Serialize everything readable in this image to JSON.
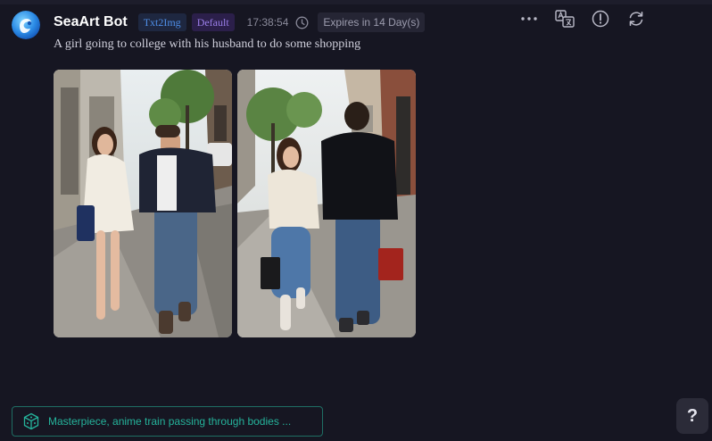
{
  "message": {
    "bot_name": "SeaArt Bot",
    "tags": [
      "Txt2Img",
      "Default"
    ],
    "time": "17:38:54",
    "expires": "Expires in 14 Day(s)",
    "prompt": "A girl going to college with his husband to do some shopping"
  },
  "toolbar": {
    "icons": [
      "more-icon",
      "translate-icon",
      "report-icon",
      "regenerate-icon"
    ]
  },
  "images": [
    {
      "alt": "Couple walking on sidewalk, woman in cream dress"
    },
    {
      "alt": "Couple walking on sidewalk holding shopping bags"
    }
  ],
  "suggestion": {
    "text": "Masterpiece, anime train passing through bodies ..."
  },
  "help": {
    "label": "?"
  },
  "colors": {
    "background": "#161622",
    "accent_teal": "#25b39b",
    "tag_blue": "#4f8fe8",
    "tag_purple": "#9a7ee8"
  }
}
